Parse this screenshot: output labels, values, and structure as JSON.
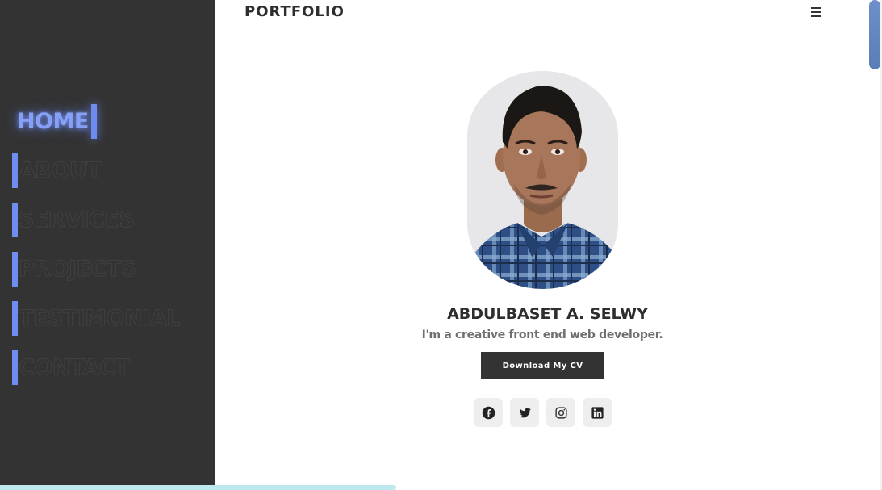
{
  "header": {
    "brand": "PORTFOLIO",
    "menu_icon": "hamburger-menu-icon"
  },
  "sidebar": {
    "items": [
      {
        "label": "HOME",
        "active": true
      },
      {
        "label": "ABOUT",
        "active": false
      },
      {
        "label": "SERVICES",
        "active": false
      },
      {
        "label": "PROJECTS",
        "active": false
      },
      {
        "label": "TESTIMONIAL",
        "active": false
      },
      {
        "label": "CONTACT",
        "active": false
      }
    ]
  },
  "profile": {
    "name": "ABDULBASET A. SELWY",
    "tagline": "I'm a creative front end web developer.",
    "cv_button_label": "Download My CV",
    "social": [
      {
        "icon": "facebook-icon"
      },
      {
        "icon": "twitter-icon"
      },
      {
        "icon": "instagram-icon"
      },
      {
        "icon": "linkedin-icon"
      }
    ]
  },
  "scroll_progress": 0.45,
  "colors": {
    "sidebar_bg": "#333333",
    "accent": "#6f8cf0",
    "button_bg": "#333333",
    "progress": "#bde9ee"
  }
}
